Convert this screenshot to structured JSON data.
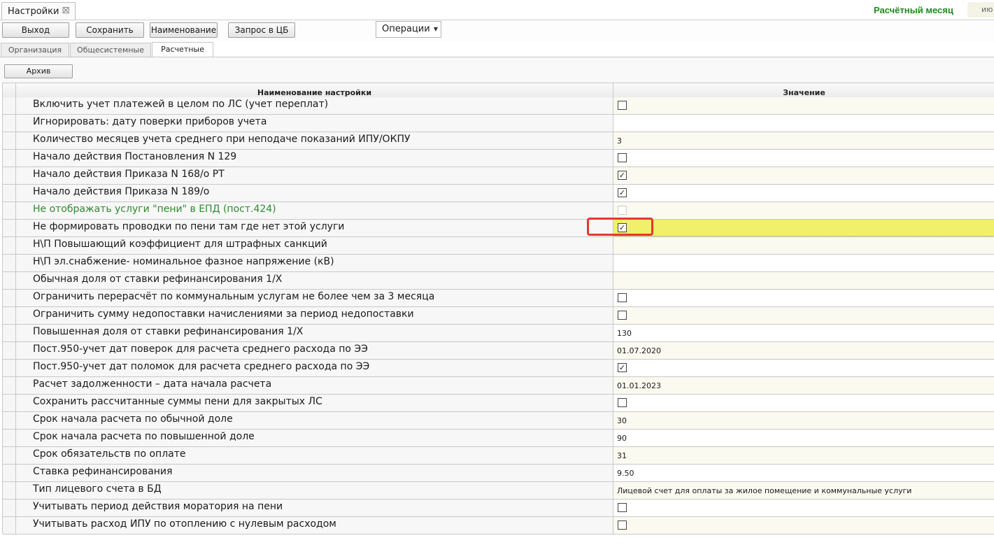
{
  "window_tab": {
    "label": "Настройки",
    "close": "⊠"
  },
  "header": {
    "month_label": "Расчётный месяц",
    "month_value": "ию"
  },
  "toolbar": {
    "exit": "Выход",
    "save": "Сохранить",
    "naming": "Наименование",
    "cb_request": "Запрос в ЦБ",
    "operations": "Операции"
  },
  "tabs": [
    "Организация",
    "Общесистемные",
    "Расчетные"
  ],
  "archive_button": "Архив",
  "grid": {
    "col_name": "Наименование настройки",
    "col_value": "Значение",
    "rows": [
      {
        "name": "Включить учет платежей в целом по ЛС (учет переплат)",
        "type": "checkbox",
        "checked": false,
        "value": ""
      },
      {
        "name": "Игнорировать: дату поверки приборов учета",
        "type": "text",
        "value": ""
      },
      {
        "name": "Количество месяцев учета среднего при неподаче показаний ИПУ/ОКПУ",
        "type": "text",
        "value": "3"
      },
      {
        "name": "Начало действия Постановления N 129",
        "type": "checkbox",
        "checked": false,
        "value": ""
      },
      {
        "name": "Начало действия Приказа N 168/о РТ",
        "type": "checkbox",
        "checked": true,
        "value": ""
      },
      {
        "name": "Начало действия Приказа N 189/о",
        "type": "checkbox",
        "checked": true,
        "value": ""
      },
      {
        "name": "Не отображать услуги \"пени\" в ЕПД (пост.424)",
        "type": "checkbox",
        "checked": false,
        "disabled": true,
        "green": true,
        "value": ""
      },
      {
        "name": "Не формировать проводки по пени там где нет этой услуги",
        "type": "checkbox",
        "checked": true,
        "highlight": true,
        "value": ""
      },
      {
        "name": "Н\\П Повышающий коэффициент для штрафных санкций",
        "type": "text",
        "value": ""
      },
      {
        "name": "Н\\П эл.снабжение- номинальное фазное напряжение (кВ)",
        "type": "text",
        "value": ""
      },
      {
        "name": "Обычная доля от ставки рефинансирования 1/X",
        "type": "text",
        "value": ""
      },
      {
        "name": "Ограничить перерасчёт по коммунальным услугам не более чем за 3 месяца",
        "type": "checkbox",
        "checked": false,
        "value": ""
      },
      {
        "name": "Ограничить сумму недопоставки начислениями за период недопоставки",
        "type": "checkbox",
        "checked": false,
        "value": ""
      },
      {
        "name": "Повышенная доля от ставки рефинансирования 1/X",
        "type": "text",
        "value": "130"
      },
      {
        "name": "Пост.950-учет дат поверок для расчета среднего расхода по ЭЭ",
        "type": "text",
        "value": "01.07.2020"
      },
      {
        "name": "Пост.950-учет дат поломок для расчета среднего расхода по ЭЭ",
        "type": "checkbox",
        "checked": true,
        "value": ""
      },
      {
        "name": "Расчет задолженности – дата начала расчета",
        "type": "text",
        "value": "01.01.2023"
      },
      {
        "name": "Сохранить рассчитанные суммы пени для закрытых ЛС",
        "type": "checkbox",
        "checked": false,
        "value": ""
      },
      {
        "name": "Срок начала расчета по обычной доле",
        "type": "text",
        "value": "30"
      },
      {
        "name": "Срок начала расчета по повышенной доле",
        "type": "text",
        "value": "90"
      },
      {
        "name": "Срок обязательств по оплате",
        "type": "text",
        "value": "31"
      },
      {
        "name": "Ставка рефинансирования",
        "type": "text",
        "value": "9.50"
      },
      {
        "name": "Тип лицевого счета в БД",
        "type": "text",
        "value": "Лицевой счет для оплаты за жилое помещение и коммунальные услуги"
      },
      {
        "name": "Учитывать период действия моратория на пени",
        "type": "checkbox",
        "checked": false,
        "value": ""
      },
      {
        "name": "Учитывать расход ИПУ по отоплению с нулевым расходом",
        "type": "checkbox",
        "checked": false,
        "value": ""
      }
    ]
  },
  "glyphs": {
    "check": "✓",
    "chevron": "▼"
  },
  "colors": {
    "highlight": "#f0f06a",
    "green_text": "#2e8b2e",
    "month_label": "#1f8a1f",
    "annotation": "#e03a2e"
  }
}
